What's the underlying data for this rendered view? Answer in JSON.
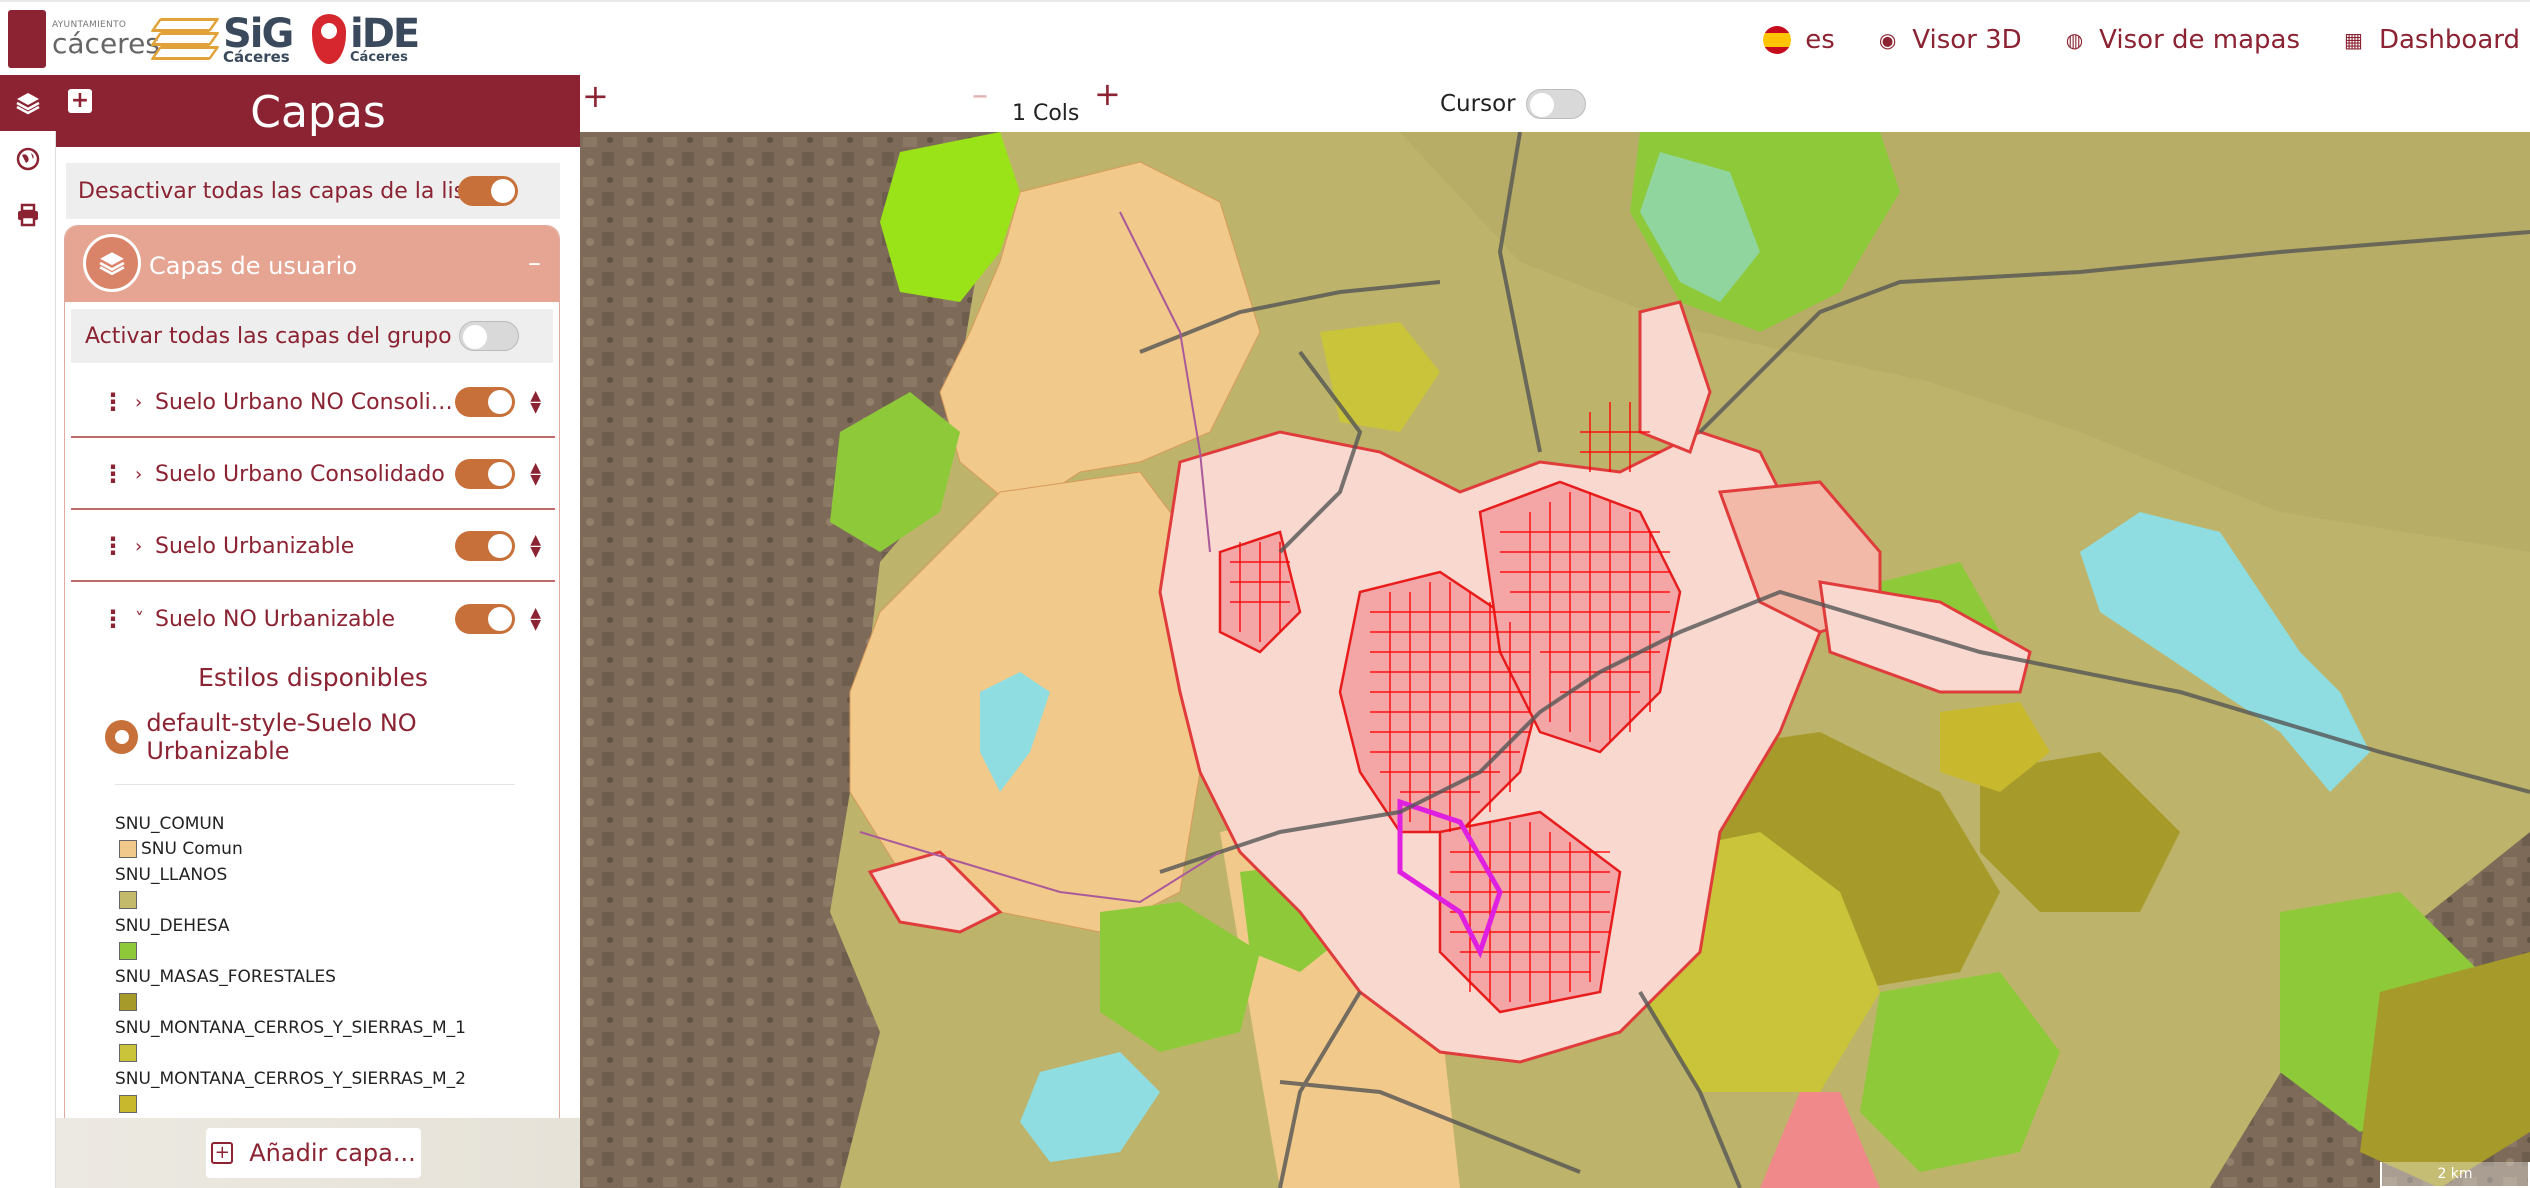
{
  "header": {
    "logo_ayuntamiento_small": "AYUNTAMIENTO",
    "logo_ayuntamiento": "cáceres",
    "logo_sig": "SiG",
    "logo_sig_sub": "Cáceres",
    "logo_ide": "iDE",
    "logo_ide_sub": "Cáceres",
    "nav": [
      {
        "icon": "spain-flag-icon",
        "label": "es"
      },
      {
        "icon": "eye-icon",
        "label": "Visor 3D"
      },
      {
        "icon": "globe-icon",
        "label": "Visor de mapas"
      },
      {
        "icon": "table-icon",
        "label": "Dashboard"
      }
    ]
  },
  "iconbar": [
    "layers-icon",
    "globe-icon",
    "print-icon"
  ],
  "panel": {
    "title": "Capas",
    "deactivate_all": "Desactivar todas las capas de la lista",
    "group": {
      "title": "Capas de usuario",
      "activate_all": "Activar todas las capas del grupo",
      "layers": [
        {
          "name": "Suelo Urbano NO Consolid...",
          "enabled": true,
          "expanded": false
        },
        {
          "name": "Suelo Urbano Consolidado",
          "enabled": true,
          "expanded": false
        },
        {
          "name": "Suelo Urbanizable",
          "enabled": true,
          "expanded": false
        },
        {
          "name": "Suelo NO Urbanizable",
          "enabled": true,
          "expanded": true
        }
      ],
      "styles_title": "Estilos disponibles",
      "selected_style": "default-style-Suelo NO Urbanizable",
      "legend": [
        {
          "group": "SNU_COMUN",
          "label": "SNU Comun",
          "color": "#f0c98b"
        },
        {
          "group": "SNU_LLANOS",
          "label": "",
          "color": "#c4ba6c"
        },
        {
          "group": "SNU_DEHESA",
          "label": "",
          "color": "#8ec93a"
        },
        {
          "group": "SNU_MASAS_FORESTALES",
          "label": "",
          "color": "#a69a2a"
        },
        {
          "group": "SNU_MONTANA_CERROS_Y_SIERRAS_M_1",
          "label": "",
          "color": "#c9c43a"
        },
        {
          "group": "SNU_MONTANA_CERROS_Y_SIERRAS_M_2",
          "label": "",
          "color": "#c8b82e"
        }
      ]
    },
    "add_layer": "Añadir capa..."
  },
  "map": {
    "cols_label": "1 Cols",
    "cursor_label": "Cursor",
    "cursor_enabled": false,
    "scale_label": "2 km"
  },
  "colors": {
    "brand": "#8b2332",
    "accent": "#c8703a",
    "group_header": "#e6a492"
  }
}
